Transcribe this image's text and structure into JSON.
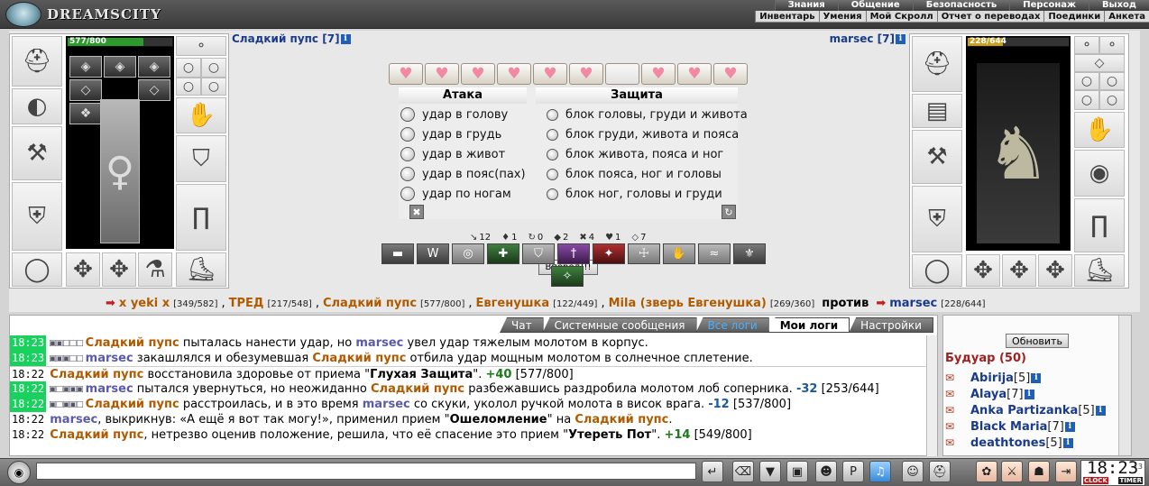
{
  "app": {
    "logo_text": "DREAMSCITY"
  },
  "menu_top": [
    "Знания",
    "Общение",
    "Безопасность",
    "Персонаж",
    "Выход"
  ],
  "menu_sub": [
    "Инвентарь",
    "Умения",
    "Мой Скролл",
    "Отчет о переводах",
    "Поединки",
    "Анкета"
  ],
  "me": {
    "name": "Сладкий пупс",
    "level": "[7]",
    "hp_text": "577/800",
    "hp_fraction": 0.72
  },
  "enemy": {
    "name": "marsec",
    "level": "[7]",
    "hp_text": "228/644",
    "hp_fraction": 0.35
  },
  "hearts": [
    true,
    true,
    true,
    true,
    true,
    true,
    false,
    true,
    true,
    true
  ],
  "attack": {
    "title": "Атака",
    "options": [
      "удар в голову",
      "удар в грудь",
      "удар в живот",
      "удар в пояс(пах)",
      "удар по ногам"
    ]
  },
  "defense": {
    "title": "Защита",
    "options": [
      "блок головы, груди и живота",
      "блок груди, живота и пояса",
      "блок живота, пояса и ног",
      "блок пояса, ног и головы",
      "блок ног, головы и груди"
    ]
  },
  "forward_label": "Вперёд!!!",
  "counters": [
    {
      "icon": "sword-icon",
      "glyph": "↘",
      "value": "12"
    },
    {
      "icon": "blood-icon",
      "glyph": "♦",
      "value": "1"
    },
    {
      "icon": "cycle-icon",
      "glyph": "↻",
      "value": "0"
    },
    {
      "icon": "shield-icon",
      "glyph": "◆",
      "value": "2"
    },
    {
      "icon": "cross-icon",
      "glyph": "✖",
      "value": "4"
    },
    {
      "icon": "heart-icon",
      "glyph": "♥",
      "value": "1"
    },
    {
      "icon": "shield-outline-icon",
      "glyph": "◇",
      "value": "7"
    }
  ],
  "combatants": {
    "left": [
      {
        "name": "x yeki x",
        "hp": "[349/582]"
      },
      {
        "name": "ТРЕД",
        "hp": "[217/548]"
      },
      {
        "name": "Сладкий пупс",
        "hp": "[577/800]"
      },
      {
        "name": "Евгенушка",
        "hp": "[122/449]"
      },
      {
        "name": "Mila (зверь Евгенушка)",
        "hp": "[269/360]"
      }
    ],
    "vs": "против",
    "right": {
      "name": "marsec",
      "hp": "[228/644]"
    }
  },
  "tabs": [
    "Чат",
    "Системные сообщения",
    "Все логи",
    "Мои логи",
    "Настройки"
  ],
  "log": [
    {
      "time": "18:23",
      "hl": true,
      "marks": "▣▣□□□",
      "parts": [
        [
          "o",
          "Сладкий пупс"
        ],
        [
          "t",
          " пыталась нанести удар, но "
        ],
        [
          "b",
          "marsec"
        ],
        [
          "t",
          " увел удар тяжелым молотом в корпус."
        ]
      ]
    },
    {
      "time": "18:23",
      "hl": true,
      "marks": "▣▣▣□□",
      "parts": [
        [
          "b",
          "marsec"
        ],
        [
          "t",
          " закашлялся и обезумевшая "
        ],
        [
          "o",
          "Сладкий пупс"
        ],
        [
          "t",
          " отбила удар мощным молотом в солнечное сплетение."
        ]
      ]
    },
    {
      "time": "18:22",
      "hl": false,
      "marks": "",
      "sep": true,
      "parts": [
        [
          "o",
          "Сладкий пупс"
        ],
        [
          "t",
          " восстановила здоровье от приема \""
        ],
        [
          "k",
          "Глухая Защита"
        ],
        [
          "t",
          "\". "
        ],
        [
          "g",
          "+40"
        ],
        [
          "t",
          " [577/800]"
        ]
      ]
    },
    {
      "time": "18:22",
      "hl": true,
      "marks": "▣□▣▣▣",
      "parts": [
        [
          "b",
          "marsec"
        ],
        [
          "t",
          " пытался увернуться, но неожиданно "
        ],
        [
          "o",
          "Сладкий пупс"
        ],
        [
          "t",
          " разбежавшись раздробила молотом лоб соперника. "
        ],
        [
          "n",
          "-32"
        ],
        [
          "t",
          " [253/644]"
        ]
      ]
    },
    {
      "time": "18:22",
      "hl": true,
      "marks": "▣□▣▣□",
      "parts": [
        [
          "o",
          "Сладкий пупс"
        ],
        [
          "t",
          " расстроилась, и в это время "
        ],
        [
          "b",
          "marsec"
        ],
        [
          "t",
          " со скуки, уколол ручкой молота в висок врага. "
        ],
        [
          "n",
          "-12"
        ],
        [
          "t",
          " [537/800]"
        ]
      ]
    },
    {
      "time": "18:22",
      "hl": false,
      "marks": "",
      "parts": [
        [
          "b",
          "marsec"
        ],
        [
          "t",
          ", выкрикнув: «А ещё я вот так могу!», применил прием \""
        ],
        [
          "k",
          "Ошеломление"
        ],
        [
          "t",
          "\" на "
        ],
        [
          "o",
          "Сладкий пупс"
        ],
        [
          "t",
          "."
        ]
      ]
    },
    {
      "time": "18:22",
      "hl": false,
      "marks": "",
      "parts": [
        [
          "o",
          "Сладкий пупс"
        ],
        [
          "t",
          ", нетрезво оценив положение, решила, что её спасение это прием \""
        ],
        [
          "k",
          "Утереть Пот"
        ],
        [
          "t",
          "\". "
        ],
        [
          "g",
          "+14"
        ],
        [
          "t",
          " [549/800]"
        ]
      ]
    }
  ],
  "boudoir": {
    "refresh_label": "Обновить",
    "title": "Будуар (50)",
    "users": [
      {
        "name": "Abirija",
        "level": "[5]"
      },
      {
        "name": "Alaya",
        "level": "[7]"
      },
      {
        "name": "Anka Partizanka",
        "level": "[5]"
      },
      {
        "name": "Black Maria",
        "level": "[7]"
      },
      {
        "name": "deathtones",
        "level": "[5]"
      }
    ]
  },
  "clock": {
    "time": "18:23",
    "seconds": "13",
    "label_left": "CLOCK",
    "label_right": "TIMER"
  },
  "colors": {
    "green_time": "#19d15e",
    "player_orange": "#b05a00",
    "player_blue": "#1a3a8a",
    "hp_green": "#2e9a2e"
  }
}
